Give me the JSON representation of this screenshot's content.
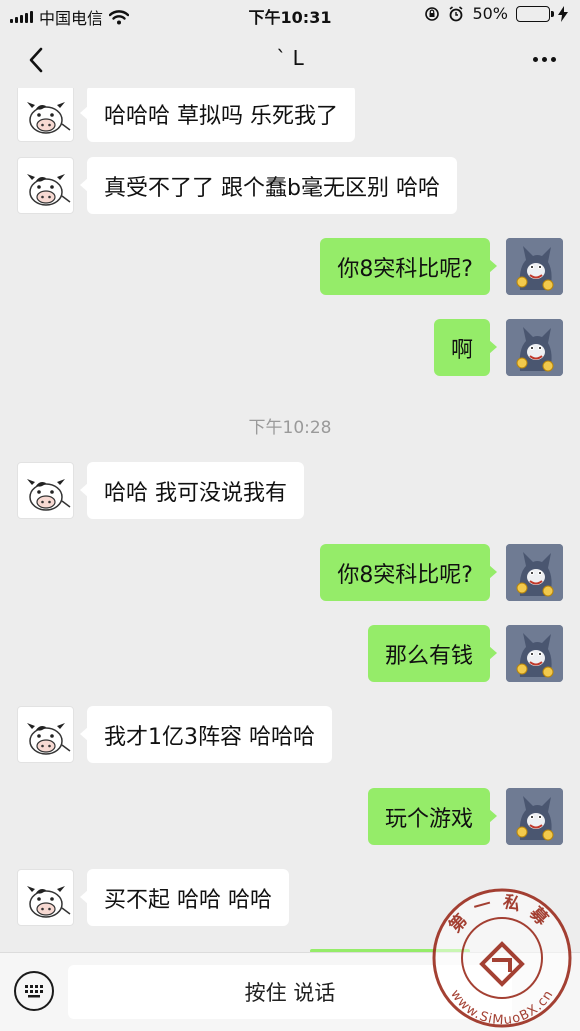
{
  "status_bar": {
    "carrier": "中国电信",
    "time": "下午10:31",
    "battery_percent": "50%",
    "battery_level": 0.5
  },
  "nav": {
    "title": "ˋ L"
  },
  "messages": [
    {
      "side": "left",
      "text": "哈哈哈 草拟吗 乐死我了"
    },
    {
      "side": "left",
      "text": "真受不了了 跟个蠢b毫无区别 哈哈"
    },
    {
      "side": "right",
      "text": "你8突科比呢?"
    },
    {
      "side": "right",
      "text": "啊"
    },
    {
      "timestamp": "下午10:28"
    },
    {
      "side": "left",
      "text": "哈哈 我可没说我有"
    },
    {
      "side": "right",
      "text": "你8突科比呢?"
    },
    {
      "side": "right",
      "text": "那么有钱"
    },
    {
      "side": "left",
      "text": "我才1亿3阵容 哈哈哈"
    },
    {
      "side": "right",
      "text": "玩个游戏"
    },
    {
      "side": "left",
      "text": "买不起 哈哈 哈哈"
    }
  ],
  "input_bar": {
    "hold_to_talk_label": "按住 说话"
  },
  "watermark": {
    "text_top": "第一私募",
    "text_bottom": "www.SiMuoBX.cn"
  },
  "colors": {
    "background": "#ededed",
    "sent_bubble": "#95ec69",
    "received_bubble": "#ffffff",
    "watermark": "#9b2d1e"
  }
}
